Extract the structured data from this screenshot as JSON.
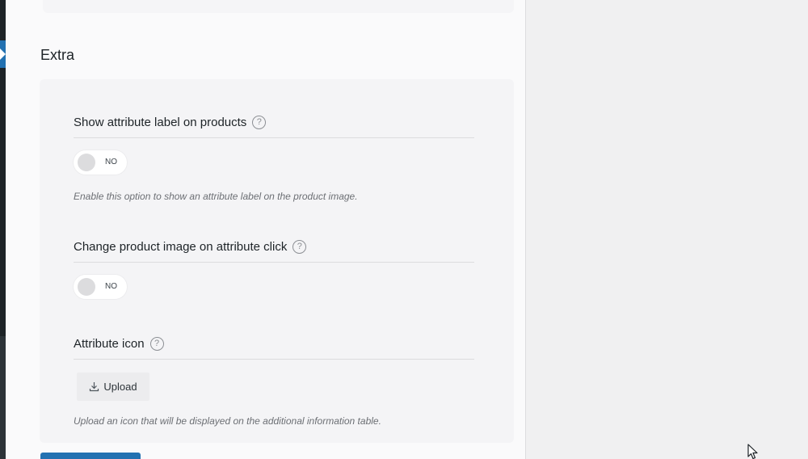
{
  "section": {
    "title": "Extra"
  },
  "fields": [
    {
      "label": "Show attribute label on products",
      "help": "?",
      "toggle_state": "NO",
      "description": "Enable this option to show an attribute label on the product image."
    },
    {
      "label": "Change product image on attribute click",
      "help": "?",
      "toggle_state": "NO"
    },
    {
      "label": "Attribute icon",
      "help": "?",
      "upload_label": "Upload",
      "description": "Upload an icon that will be displayed on the additional information table."
    }
  ],
  "colors": {
    "accent": "#2271b1",
    "admin_bar": "#1d2327"
  },
  "icons": {
    "help": "question-circle-icon",
    "upload": "download-icon",
    "cursor": "mouse-pointer-icon"
  }
}
